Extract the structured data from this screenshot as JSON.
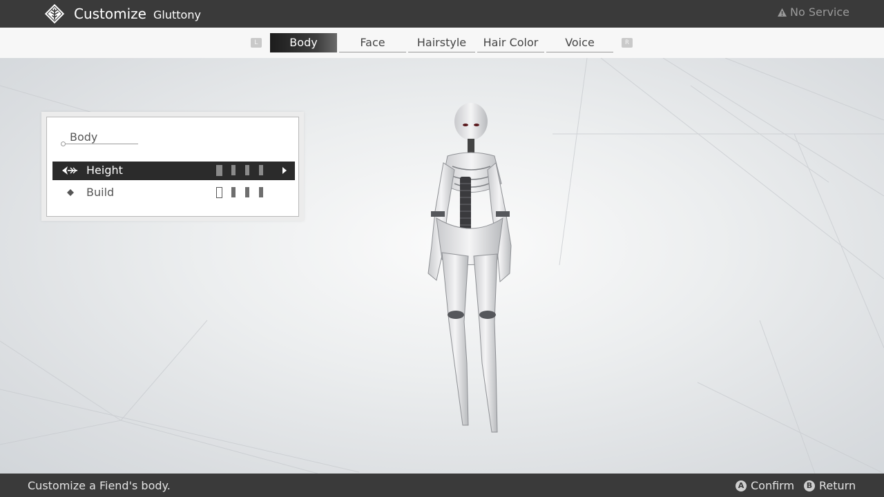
{
  "header": {
    "title": "Customize",
    "subtitle": "Gluttony",
    "status_icon": "warning-icon",
    "status_text": "No Service"
  },
  "tabs": {
    "left_hint": "L",
    "right_hint": "R",
    "items": [
      {
        "label": "Body",
        "active": true
      },
      {
        "label": "Face",
        "active": false
      },
      {
        "label": "Hairstyle",
        "active": false
      },
      {
        "label": "Hair Color",
        "active": false
      },
      {
        "label": "Voice",
        "active": false
      }
    ]
  },
  "panel": {
    "title": "Body",
    "options": [
      {
        "label": "Height",
        "selected": true,
        "level": 1,
        "levels": 4
      },
      {
        "label": "Build",
        "selected": false,
        "level": 1,
        "levels": 4
      }
    ]
  },
  "footer": {
    "help_text": "Customize a Fiend's body.",
    "confirm_button": "A",
    "confirm_label": "Confirm",
    "return_button": "B",
    "return_label": "Return"
  },
  "colors": {
    "bar_dark": "#3a3a3a",
    "tab_bg": "#f7f7f7",
    "selected_row": "#2b2b2b"
  }
}
